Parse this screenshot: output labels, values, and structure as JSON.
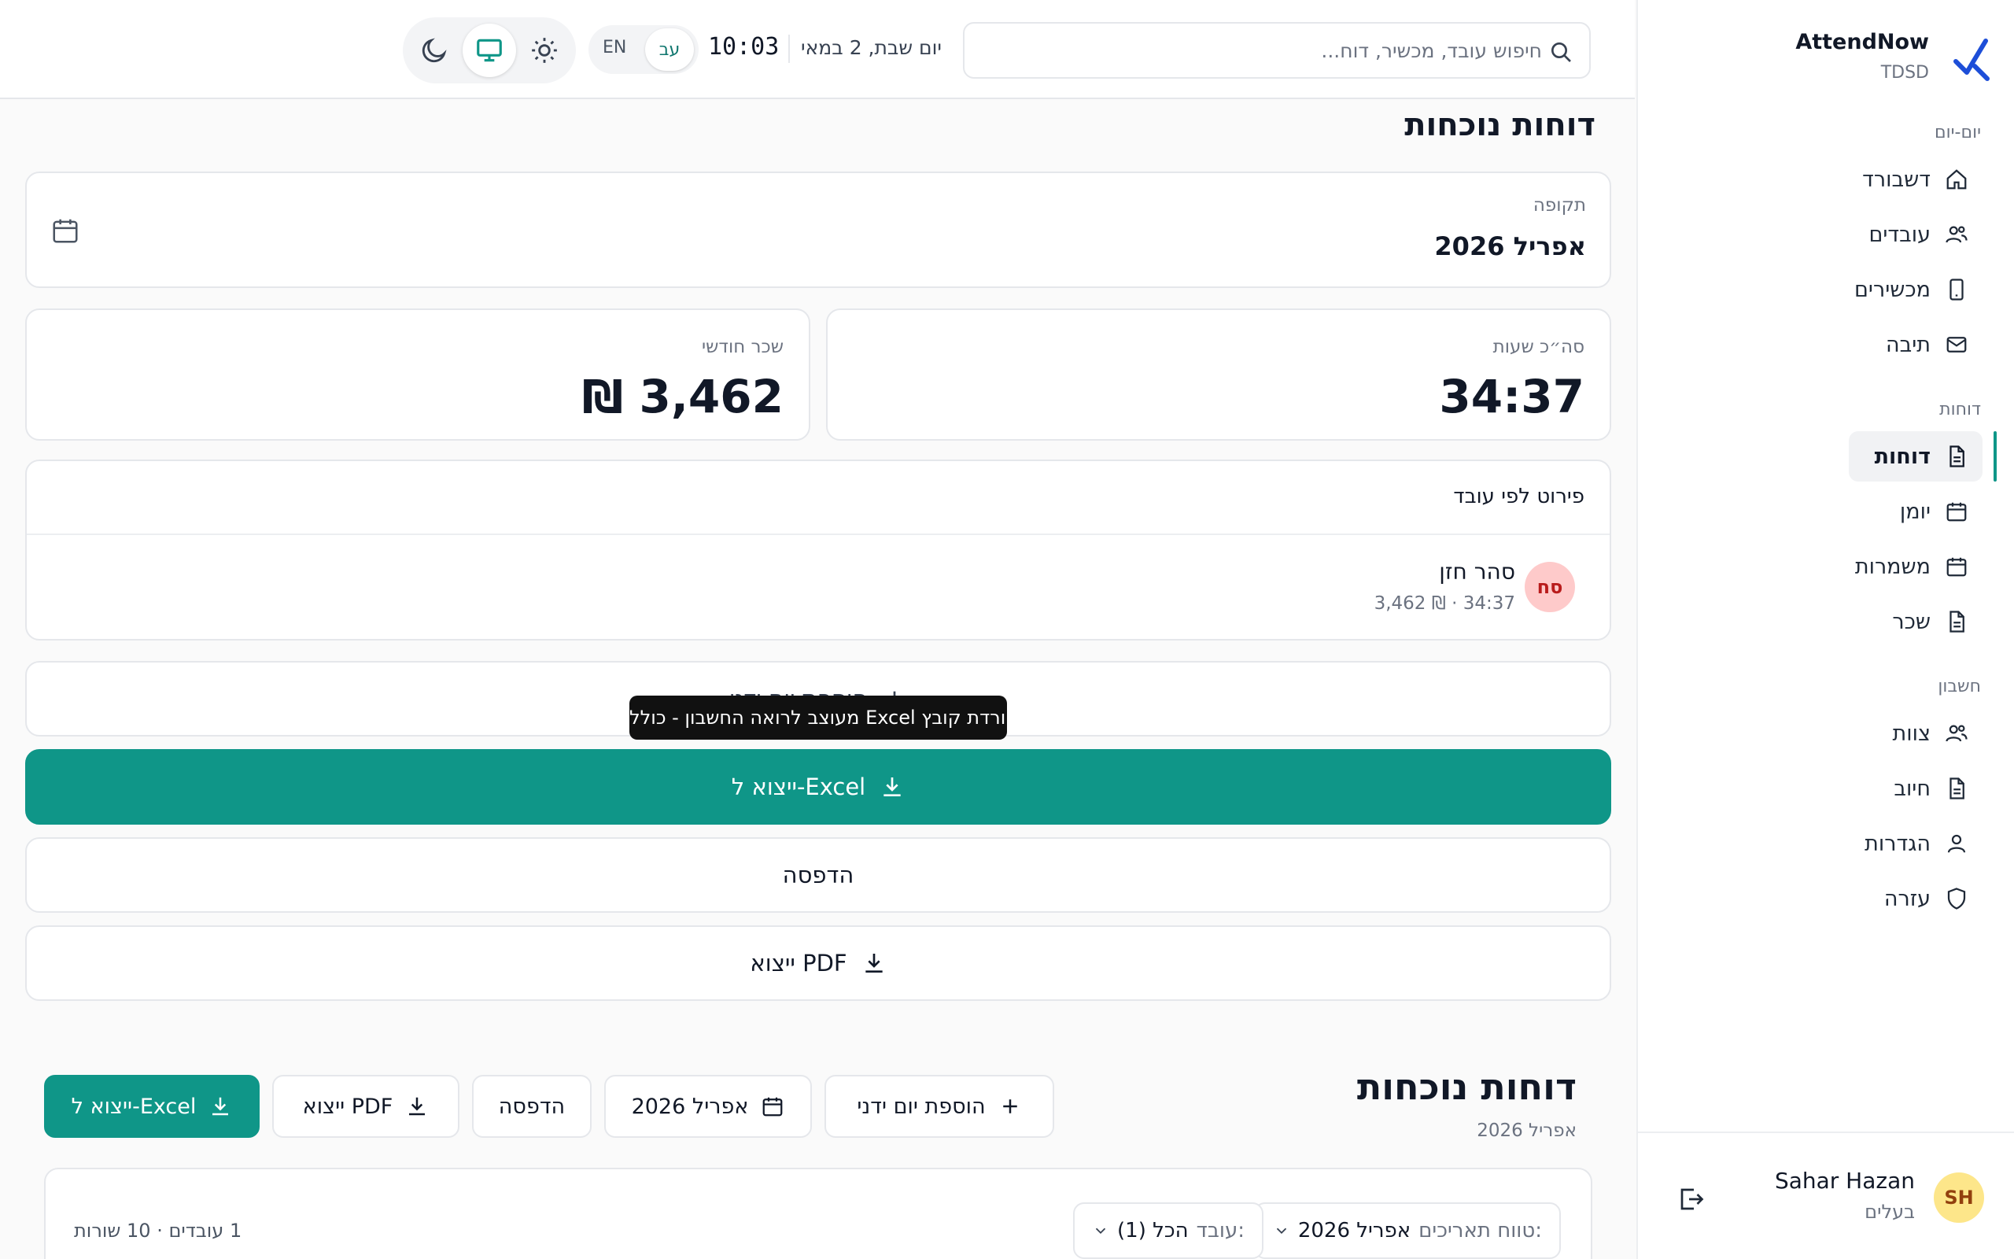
{
  "brand": {
    "name": "AttendNow",
    "sub": "TDSD"
  },
  "nav": {
    "section_daily": "יום-יום",
    "section_reports": "דוחות",
    "section_account": "חשבון",
    "items": [
      {
        "label": "דשבורד",
        "icon": "home-icon"
      },
      {
        "label": "עובדים",
        "icon": "users-icon"
      },
      {
        "label": "מכשירים",
        "icon": "device-icon"
      },
      {
        "label": "תיבה",
        "icon": "mail-icon"
      },
      {
        "label": "דוחות",
        "icon": "file-icon",
        "active": true
      },
      {
        "label": "יומן",
        "icon": "calendar-icon"
      },
      {
        "label": "משמרות",
        "icon": "calendar-icon"
      },
      {
        "label": "שכר",
        "icon": "file-icon"
      },
      {
        "label": "צוות",
        "icon": "users-icon"
      },
      {
        "label": "חיוב",
        "icon": "file-icon"
      },
      {
        "label": "הגדרות",
        "icon": "user-icon"
      },
      {
        "label": "עזרה",
        "icon": "shield-icon"
      }
    ]
  },
  "user": {
    "initials": "SH",
    "name": "Sahar Hazan",
    "role": "בעלים"
  },
  "topbar": {
    "search_placeholder": "חיפוש עובד, מכשיר, דוח...",
    "date": "יום שבת, 2 במאי",
    "time": "10:03",
    "lang_en": "EN",
    "lang_he": "עב",
    "theme_active": "system"
  },
  "main": {
    "title": "דוחות נוכחות",
    "period": {
      "label": "תקופה",
      "value": "אפריל 2026"
    },
    "stats": {
      "hours": {
        "label": "סה״כ שעות",
        "value": "34:37"
      },
      "salary": {
        "label": "שכר חודשי",
        "value": "₪ 3,462"
      }
    },
    "breakdown": {
      "title": "פירוט לפי עובד",
      "employees": [
        {
          "initials": "סח",
          "name": "סהר חזן",
          "meta": "34:37 · ₪ 3,462"
        }
      ]
    },
    "actions": {
      "add_manual_day": "הוספת יום ידני",
      "excel": "ייצוא ל-Excel",
      "print": "הדפסה",
      "pdf": "ייצוא PDF"
    },
    "tooltip": "הורדת קובץ Excel מעוצב לרואה החשבון - כולל"
  },
  "lower": {
    "title": "דוחות נוכחות",
    "subtitle": "אפריל 2026",
    "buttons": {
      "add_manual_day": "הוספת יום ידני",
      "period": "אפריל 2026",
      "print": "הדפסה",
      "pdf": "ייצוא PDF",
      "excel": "ייצוא ל-Excel"
    },
    "filters": {
      "range_label": "טווח תאריכים:",
      "range_value": "אפריל 2026",
      "employee_label": "עובד:",
      "employee_value": "הכל (1)"
    },
    "row_count": "1 עובדים · 10 שורות"
  },
  "colors": {
    "accent": "#0f9688",
    "avatar_user": "#fde68a",
    "avatar_employee": "#fecaca"
  }
}
